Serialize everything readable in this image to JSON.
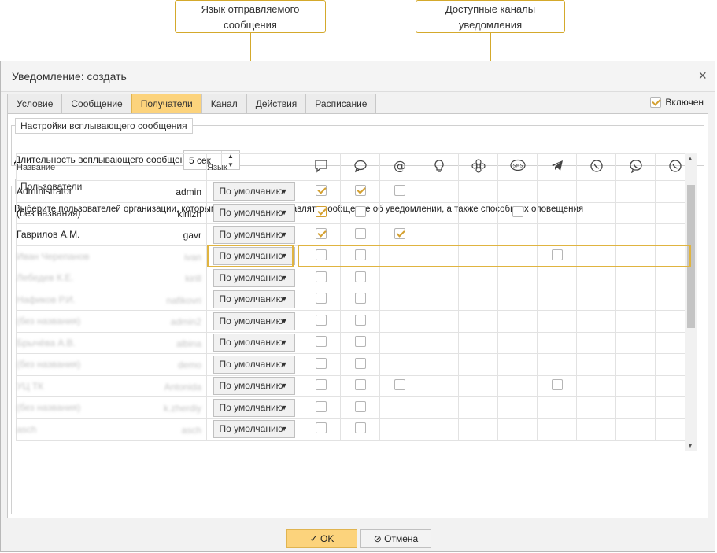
{
  "callouts": {
    "language": "Язык отправляемого сообщения",
    "channels": "Доступные каналы уведомления"
  },
  "dialog": {
    "title": "Уведомление: создать",
    "close_icon": "×",
    "tabs": [
      "Условие",
      "Сообщение",
      "Получатели",
      "Канал",
      "Действия",
      "Расписание"
    ],
    "active_tab": "Получатели",
    "enabled_label": "Включен"
  },
  "popup": {
    "legend": "Настройки всплывающего сообщения",
    "duration_label": "Длительность всплывающего сообщения",
    "duration_value": "5 сек"
  },
  "users": {
    "legend": "Пользователи",
    "description": "Выберите пользователей организации, которым необходимо отправлять сообщение об уведомлении, а также способы их оповещения",
    "col_name": "Название",
    "col_lang": "Язык",
    "channel_icons": [
      "chat-bubble-icon",
      "chat-oval-icon",
      "email-at-icon",
      "lightbulb-icon",
      "flower-icon",
      "sms-icon",
      "telegram-icon",
      "viber-icon",
      "viber-alt-icon",
      "whatsapp-icon"
    ],
    "rows": [
      {
        "name": "Administrator",
        "login": "admin",
        "lang": "По умолчанию",
        "blur": false,
        "cb": [
          1,
          1,
          0,
          null,
          null,
          null,
          null,
          null,
          null,
          null
        ]
      },
      {
        "name": "(без названия)",
        "login": "kirllzh",
        "lang": "По умолчанию",
        "blur": false,
        "cb": [
          1,
          0,
          null,
          null,
          null,
          0,
          null,
          null,
          null,
          null
        ]
      },
      {
        "name": "Гаврилов А.М.",
        "login": "gavr",
        "lang": "По умолчанию",
        "blur": false,
        "cb": [
          1,
          0,
          1,
          null,
          null,
          null,
          null,
          null,
          null,
          null
        ]
      },
      {
        "name": "Иван Черепанов",
        "login": "ivan",
        "lang": "По умолчанию",
        "blur": true,
        "cb": [
          0,
          0,
          null,
          null,
          null,
          null,
          0,
          null,
          null,
          null
        ]
      },
      {
        "name": "Лебедев К.Е.",
        "login": "kirill",
        "lang": "По умолчанию",
        "blur": true,
        "cb": [
          0,
          0,
          null,
          null,
          null,
          null,
          null,
          null,
          null,
          null
        ]
      },
      {
        "name": "Нафиков Р.И.",
        "login": "nafikovri",
        "lang": "По умолчанию",
        "blur": true,
        "cb": [
          0,
          0,
          null,
          null,
          null,
          null,
          null,
          null,
          null,
          null
        ]
      },
      {
        "name": "(без названия)",
        "login": "admin2",
        "lang": "По умолчанию",
        "blur": true,
        "cb": [
          0,
          0,
          null,
          null,
          null,
          null,
          null,
          null,
          null,
          null
        ]
      },
      {
        "name": "Брычёва А.В.",
        "login": "albina",
        "lang": "По умолчанию",
        "blur": true,
        "cb": [
          0,
          0,
          null,
          null,
          null,
          null,
          null,
          null,
          null,
          null
        ]
      },
      {
        "name": "(без названия)",
        "login": "demo",
        "lang": "По умолчанию",
        "blur": true,
        "cb": [
          0,
          0,
          null,
          null,
          null,
          null,
          null,
          null,
          null,
          null
        ]
      },
      {
        "name": "УЦ ТК",
        "login": "Antonida",
        "lang": "По умолчанию",
        "blur": true,
        "cb": [
          0,
          0,
          0,
          null,
          null,
          null,
          0,
          null,
          null,
          null
        ]
      },
      {
        "name": "(без названия)",
        "login": "k.zherdiy",
        "lang": "По умолчанию",
        "blur": true,
        "cb": [
          0,
          0,
          null,
          null,
          null,
          null,
          null,
          null,
          null,
          null
        ]
      },
      {
        "name": "asch",
        "login": "asch",
        "lang": "По умолчанию",
        "blur": true,
        "cb": [
          0,
          0,
          null,
          null,
          null,
          null,
          null,
          null,
          null,
          null
        ]
      }
    ]
  },
  "footer": {
    "ok_label": "OK",
    "cancel_label": "Отмена"
  },
  "colors": {
    "accent": "#fcd37c",
    "callout_border": "#d4a92c"
  }
}
